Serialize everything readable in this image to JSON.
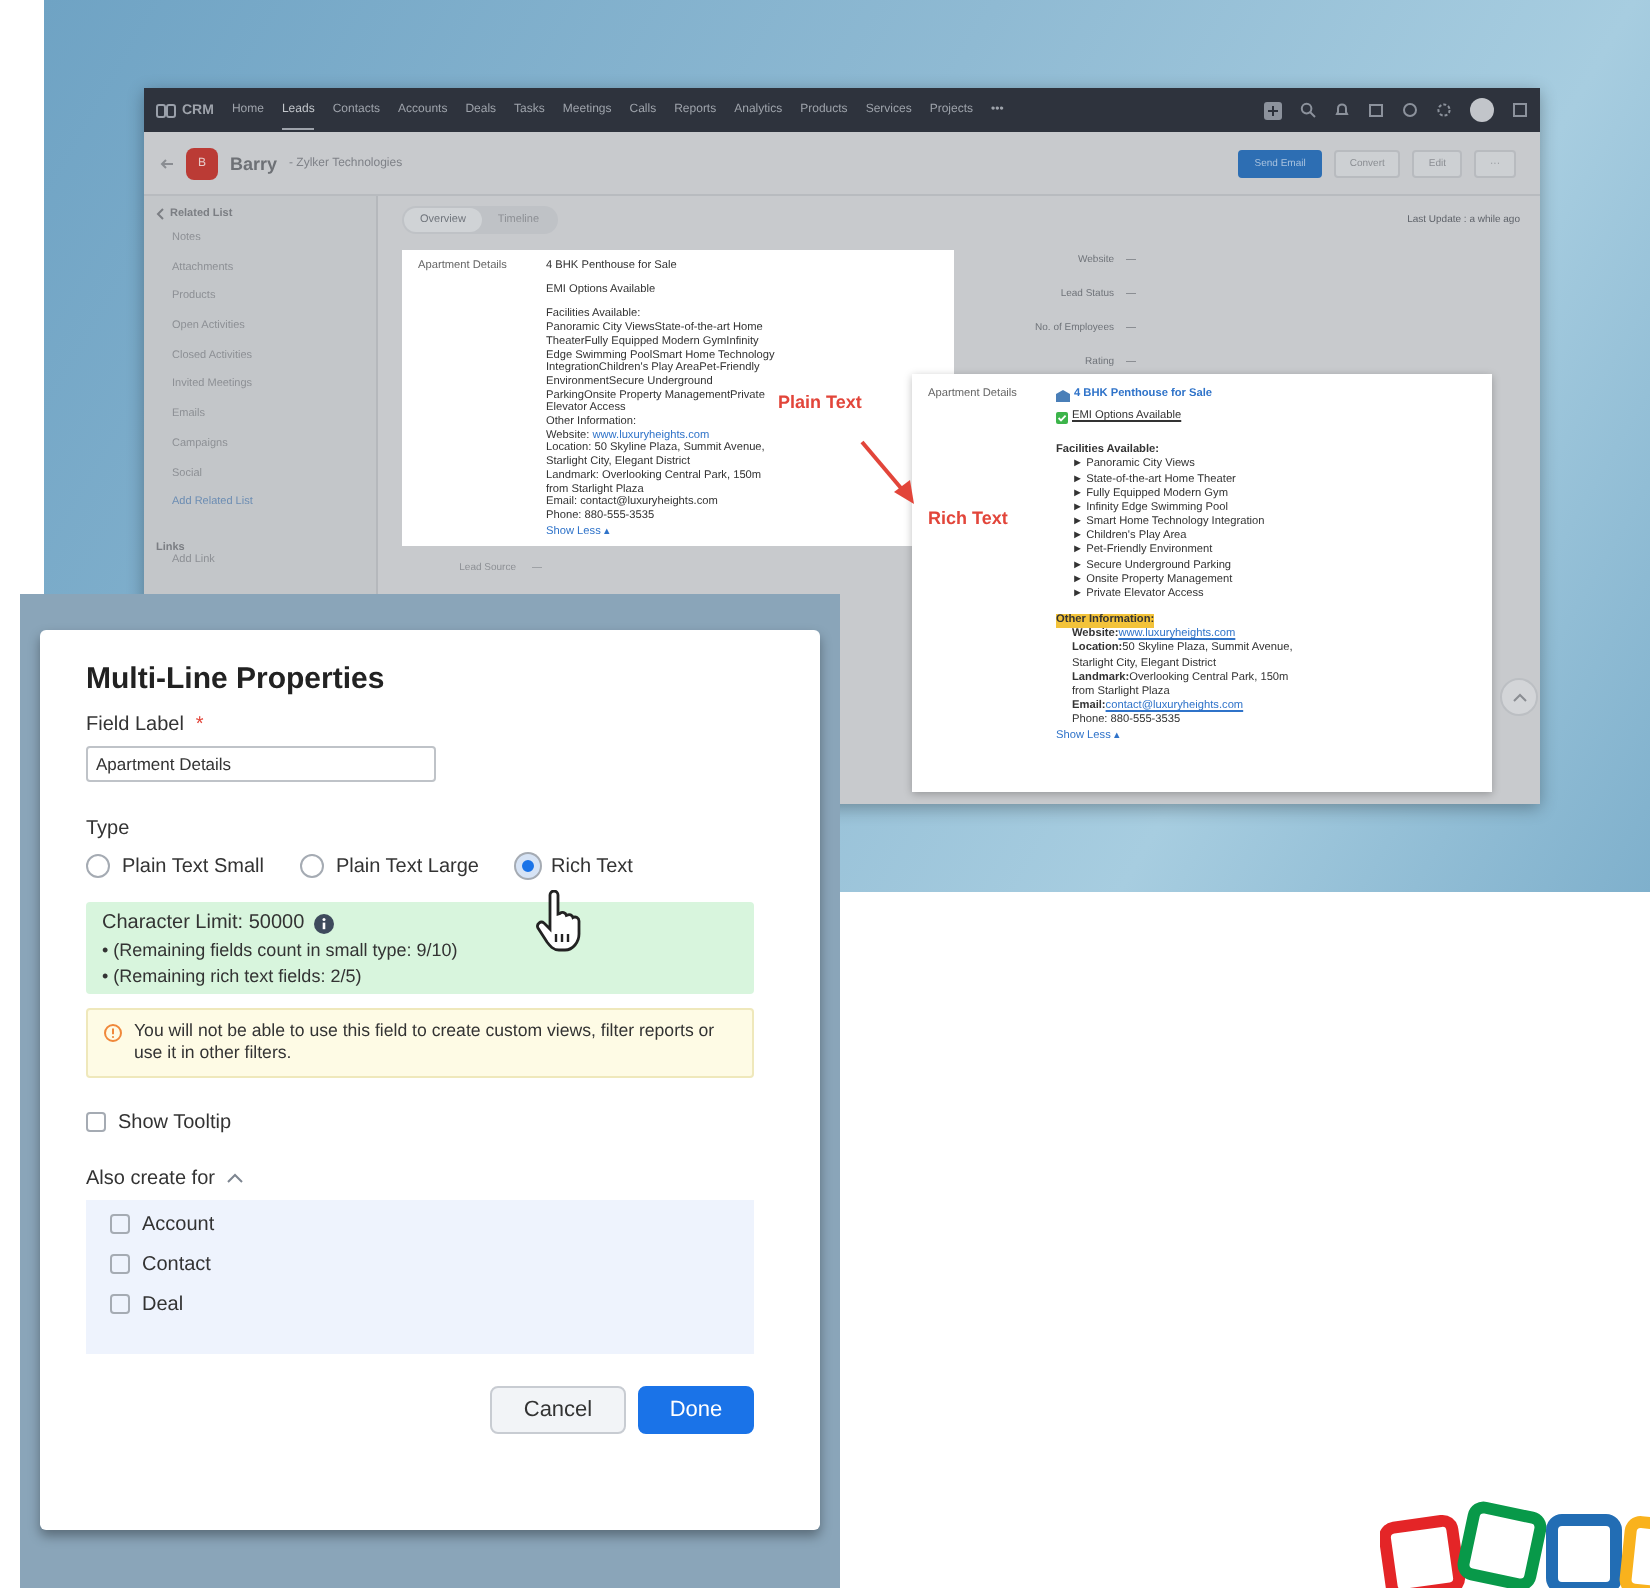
{
  "crm": {
    "brand": "CRM",
    "nav": [
      {
        "label": "Home",
        "selected": false
      },
      {
        "label": "Leads",
        "selected": true
      },
      {
        "label": "Contacts",
        "selected": false
      },
      {
        "label": "Accounts",
        "selected": false
      },
      {
        "label": "Deals",
        "selected": false
      },
      {
        "label": "Tasks",
        "selected": false
      },
      {
        "label": "Meetings",
        "selected": false
      },
      {
        "label": "Calls",
        "selected": false
      },
      {
        "label": "Reports",
        "selected": false
      },
      {
        "label": "Analytics",
        "selected": false
      },
      {
        "label": "Products",
        "selected": false
      },
      {
        "label": "Services",
        "selected": false
      },
      {
        "label": "Projects",
        "selected": false
      },
      {
        "label": "•••",
        "selected": false
      }
    ],
    "record": {
      "initial": "B",
      "name": "Barry",
      "company": "- Zylker Technologies"
    },
    "actions": [
      {
        "label": "Send Email",
        "kind": "primary"
      },
      {
        "label": "Convert",
        "kind": "secondary"
      },
      {
        "label": "Edit",
        "kind": "secondary"
      },
      {
        "label": "···",
        "kind": "secondary"
      }
    ],
    "related_title": "Related List",
    "related": [
      "Notes",
      "Attachments",
      "Products",
      "Open Activities",
      "Closed Activities",
      "Invited Meetings",
      "Emails",
      "Campaigns",
      "Social"
    ],
    "add_related": "Add Related List",
    "links_title": "Links",
    "add_link": "Add Link",
    "tabs": [
      {
        "label": "Overview",
        "selected": true
      },
      {
        "label": "Timeline",
        "selected": false
      }
    ],
    "last_update": "Last Update : a while ago",
    "fields": [
      {
        "label": "Website",
        "value": "—"
      },
      {
        "label": "Lead Status",
        "value": "—"
      },
      {
        "label": "No. of Employees",
        "value": "—"
      },
      {
        "label": "Rating",
        "value": "—"
      }
    ],
    "lower_fields": [
      {
        "label": "Lead Source",
        "value": "—"
      }
    ]
  },
  "plain_card": {
    "label": "Apartment Details",
    "title": "4 BHK Penthouse for Sale",
    "subtitle": "EMI Options Available",
    "lines": [
      {
        "text": "Facilities Available:"
      },
      {
        "text": "Panoramic City ViewsState-of-the-art Home TheaterFully Equipped Modern GymInfinity Edge Swimming PoolSmart Home Technology IntegrationChildren's Play AreaPet-Friendly EnvironmentSecure Underground ParkingOnsite Property ManagementPrivate Elevator Access"
      },
      {
        "text": "Other Information:"
      },
      {
        "text": "Website:",
        "link": "www.luxuryheights.com"
      },
      {
        "text": "Location: 50 Skyline Plaza, Summit Avenue, Starlight City, Elegant District"
      },
      {
        "text": "Landmark: Overlooking Central Park, 150m from Starlight Plaza"
      },
      {
        "text": "Email: contact@luxuryheights.com"
      },
      {
        "text": "Phone: 880-555-3535"
      }
    ],
    "show_less": "Show Less ▴"
  },
  "rich_card": {
    "label": "Apartment Details",
    "title": "4 BHK Penthouse for Sale",
    "emi": "EMI Options Available",
    "facilities_title": "Facilities Available:",
    "facilities": [
      "► Panoramic City Views",
      "► State-of-the-art Home Theater",
      "► Fully Equipped Modern Gym",
      "► Infinity Edge Swimming Pool",
      "► Smart Home Technology Integration",
      "► Children's Play Area",
      "► Pet-Friendly Environment",
      "► Secure Underground Parking",
      "► Onsite Property Management",
      "► Private Elevator Access"
    ],
    "other_title": "Other Information:",
    "other": [
      {
        "label": "Website:",
        "value": "www.luxuryheights.com",
        "kind": "link"
      },
      {
        "label": "Location:",
        "value": "50 Skyline Plaza, Summit Avenue, Starlight City, Elegant District",
        "kind": "text"
      },
      {
        "label": "Landmark:",
        "value": "Overlooking Central Park, 150m from Starlight Plaza",
        "kind": "text"
      },
      {
        "label": "Email:",
        "value": "contact@luxuryheights.com",
        "kind": "link"
      },
      {
        "value": "Phone: 880-555-3535",
        "kind": "text"
      }
    ],
    "show_less": "Show Less ▴"
  },
  "callouts": {
    "plain": "Plain Text",
    "rich": "Rich Text"
  },
  "dialog": {
    "title": "Multi-Line Properties",
    "field_label": "Field Label",
    "required": "*",
    "field_value": "Apartment Details",
    "type_label": "Type",
    "types": [
      {
        "label": "Plain Text Small",
        "selected": false
      },
      {
        "label": "Plain Text Large",
        "selected": false
      },
      {
        "label": "Rich Text",
        "selected": true
      }
    ],
    "limit": "Character Limit: 50000",
    "notes": [
      "• (Remaining fields count in small type: 9/10)",
      "• (Remaining rich text fields: 2/5)"
    ],
    "warning": "You will not be able to use this field to create custom views, filter reports or use it in other filters.",
    "tooltip": {
      "label": "Show Tooltip",
      "checked": false
    },
    "also_label": "Also create for",
    "also_expanded": true,
    "modules": [
      {
        "label": "Account",
        "checked": false
      },
      {
        "label": "Contact",
        "checked": false
      },
      {
        "label": "Deal",
        "checked": false
      }
    ],
    "buttons": [
      {
        "label": "Cancel",
        "kind": "secondary"
      },
      {
        "label": "Done",
        "kind": "primary"
      }
    ]
  }
}
